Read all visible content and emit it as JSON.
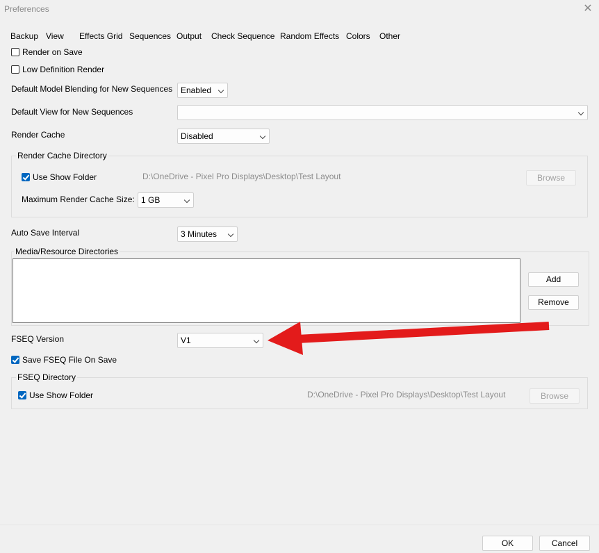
{
  "window": {
    "title": "Preferences",
    "close_icon": "close-icon"
  },
  "tabs": [
    "Backup",
    "View",
    "Effects Grid",
    "Sequences",
    "Output",
    "Check Sequence",
    "Random Effects",
    "Colors",
    "Other"
  ],
  "active_tab": "Sequences",
  "render_on_save": {
    "label": "Render on Save",
    "checked": false
  },
  "low_def_render": {
    "label": "Low Definition Render",
    "checked": false
  },
  "model_blending": {
    "label": "Default Model Blending for New Sequences",
    "value": "Enabled"
  },
  "default_view": {
    "label": "Default View for New Sequences",
    "value": ""
  },
  "render_cache": {
    "label": "Render Cache",
    "value": "Disabled"
  },
  "render_cache_dir": {
    "title": "Render Cache Directory",
    "use_show_folder": {
      "label": "Use Show Folder",
      "checked": true
    },
    "path": "D:\\OneDrive - Pixel Pro Displays\\Desktop\\Test Layout",
    "browse_label": "Browse",
    "max_size_label": "Maximum Render Cache Size:",
    "max_size_value": "1 GB"
  },
  "auto_save": {
    "label": "Auto Save Interval",
    "value": "3 Minutes"
  },
  "media_dirs": {
    "title": "Media/Resource Directories",
    "add_label": "Add",
    "remove_label": "Remove"
  },
  "fseq_version": {
    "label": "FSEQ Version",
    "value": "V1"
  },
  "save_fseq": {
    "label": "Save FSEQ File On Save",
    "checked": true
  },
  "fseq_dir": {
    "title": "FSEQ Directory",
    "use_show_folder": {
      "label": "Use Show Folder",
      "checked": true
    },
    "path": "D:\\OneDrive - Pixel Pro Displays\\Desktop\\Test Layout",
    "browse_label": "Browse"
  },
  "footer": {
    "ok_label": "OK",
    "cancel_label": "Cancel"
  },
  "annotation": {
    "color": "#e31b1b",
    "icon": "red-arrow-annotation"
  }
}
